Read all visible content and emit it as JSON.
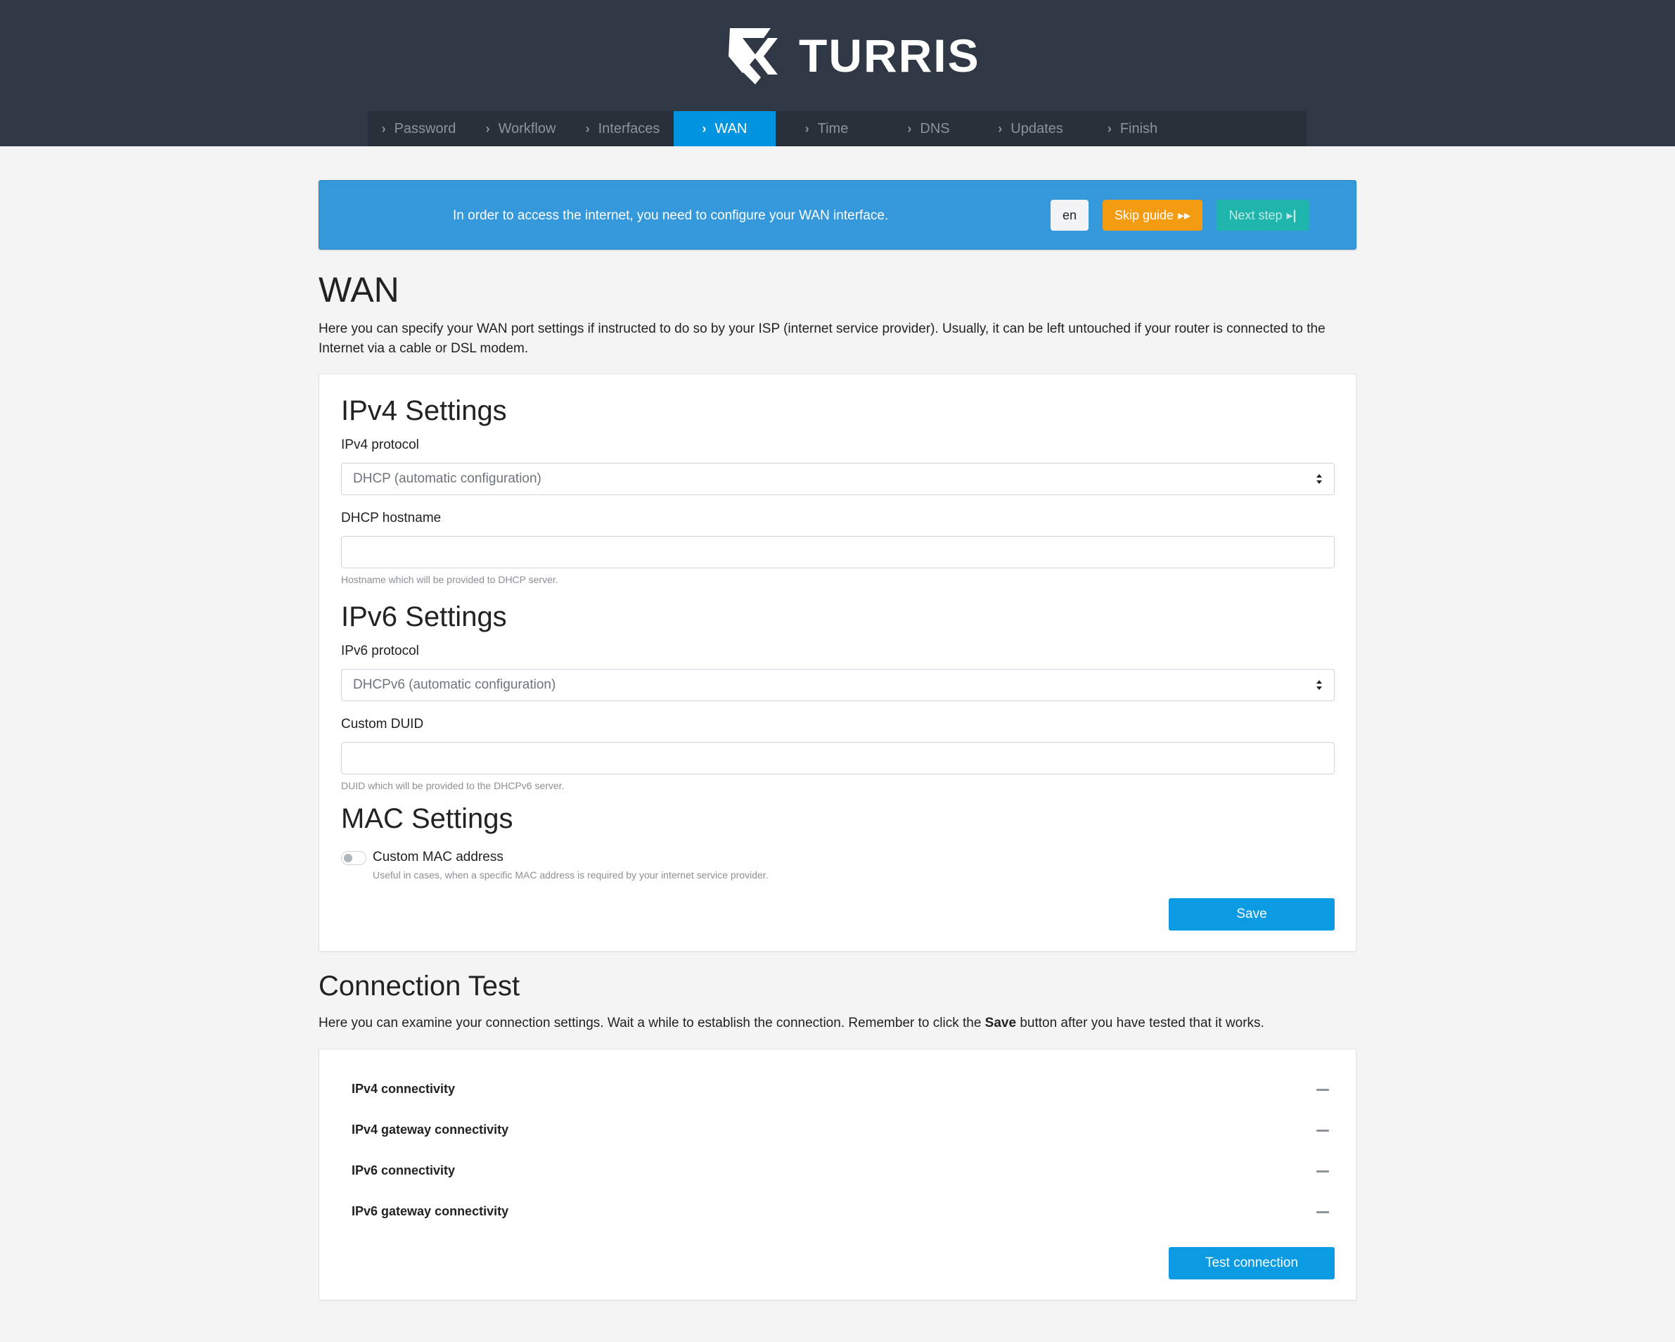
{
  "brand": {
    "name": "TURRIS"
  },
  "steps": [
    {
      "label": "Password",
      "active": false
    },
    {
      "label": "Workflow",
      "active": false
    },
    {
      "label": "Interfaces",
      "active": false
    },
    {
      "label": "WAN",
      "active": true
    },
    {
      "label": "Time",
      "active": false
    },
    {
      "label": "DNS",
      "active": false
    },
    {
      "label": "Updates",
      "active": false
    },
    {
      "label": "Finish",
      "active": false
    }
  ],
  "guide": {
    "message": "In order to access the internet, you need to configure your WAN interface.",
    "lang": "en",
    "skip_label": "Skip guide",
    "next_label": "Next step"
  },
  "page": {
    "title": "WAN",
    "description": "Here you can specify your WAN port settings if instructed to do so by your ISP (internet service provider). Usually, it can be left untouched if your router is connected to the Internet via a cable or DSL modem."
  },
  "ipv4": {
    "heading": "IPv4 Settings",
    "protocol_label": "IPv4 protocol",
    "protocol_value": "DHCP (automatic configuration)",
    "hostname_label": "DHCP hostname",
    "hostname_value": "",
    "hostname_help": "Hostname which will be provided to DHCP server."
  },
  "ipv6": {
    "heading": "IPv6 Settings",
    "protocol_label": "IPv6 protocol",
    "protocol_value": "DHCPv6 (automatic configuration)",
    "duid_label": "Custom DUID",
    "duid_value": "",
    "duid_help": "DUID which will be provided to the DHCPv6 server."
  },
  "mac": {
    "heading": "MAC Settings",
    "toggle_label": "Custom MAC address",
    "toggle_help": "Useful in cases, when a specific MAC address is required by your internet service provider.",
    "enabled": false
  },
  "save_label": "Save",
  "connection_test": {
    "title": "Connection Test",
    "desc_before": "Here you can examine your connection settings. Wait a while to establish the connection. Remember to click the ",
    "desc_bold": "Save",
    "desc_after": " button after you have tested that it works.",
    "rows": [
      {
        "label": "IPv4 connectivity"
      },
      {
        "label": "IPv4 gateway connectivity"
      },
      {
        "label": "IPv6 connectivity"
      },
      {
        "label": "IPv6 gateway connectivity"
      }
    ],
    "button_label": "Test connection"
  }
}
